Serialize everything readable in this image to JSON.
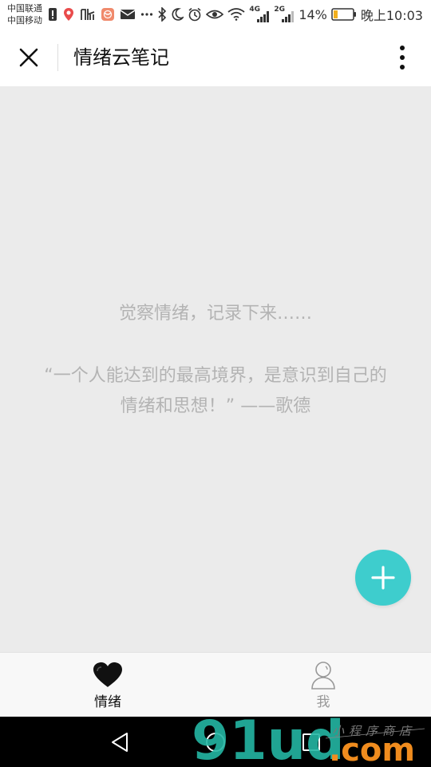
{
  "status_bar": {
    "carrier_1": "中国联通",
    "carrier_2": "中国移动",
    "network_1": "4G",
    "network_2": "2G",
    "battery": "14%",
    "time": "晚上10:03",
    "icons": [
      "alert-icon",
      "maps-icon",
      "ting-icon",
      "mail-app-icon",
      "envelope-icon",
      "more-notifications-icon",
      "bluetooth-icon",
      "moon-icon",
      "alarm-icon",
      "eye-icon",
      "wifi-icon",
      "signal-icon",
      "battery-icon"
    ]
  },
  "title_bar": {
    "title": "情绪云笔记"
  },
  "main": {
    "slogan": "觉察情绪，记录下来……",
    "quote_line1": "“一个人能达到的最高境界，是意识到自己的",
    "quote_line2": "情绪和思想！”  ——歌德"
  },
  "tabs": [
    {
      "label": "情绪",
      "icon": "heart-icon",
      "active": true
    },
    {
      "label": "我",
      "icon": "person-icon",
      "active": false
    }
  ],
  "colors": {
    "accent": "#3ecdcd",
    "content_bg": "#ebebeb",
    "muted_text": "#b3b3b3",
    "active_tab": "#111111",
    "inactive_tab": "#999999"
  },
  "watermark": {
    "brand": "91ud",
    "domain": ".com",
    "tagline": "小程序商店"
  }
}
